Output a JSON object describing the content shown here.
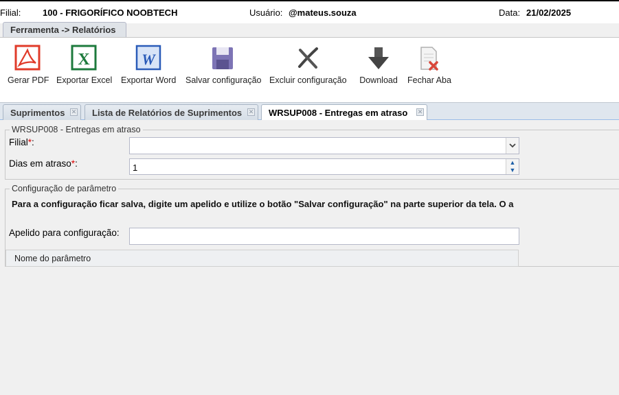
{
  "header": {
    "filial_label": "Filial:",
    "filial_value": "100 - FRIGORÍFICO NOOBTECH",
    "usuario_label": "Usuário:",
    "usuario_value": "@mateus.souza",
    "data_label": "Data:",
    "data_value": "21/02/2025"
  },
  "tool_tab": "Ferramenta -> Relatórios",
  "toolbar": {
    "gerar_pdf": "Gerar PDF",
    "exportar_excel": "Exportar Excel",
    "exportar_word": "Exportar Word",
    "salvar_config": "Salvar configuração",
    "excluir_config": "Excluir configuração",
    "download": "Download",
    "fechar_aba": "Fechar Aba"
  },
  "tabs": [
    {
      "label": "Suprimentos"
    },
    {
      "label": "Lista de Relatórios de Suprimentos"
    },
    {
      "label": "WRSUP008 - Entregas em atraso"
    }
  ],
  "form": {
    "legend": "WRSUP008 - Entregas em atraso",
    "filial_label": "Filial",
    "filial_value": "",
    "dias_label": "Dias em atraso",
    "dias_value": "1",
    "required_mark": "*",
    "colon": ":"
  },
  "config": {
    "legend": "Configuração de parâmetro",
    "info": "Para a configuração ficar salva, digite um apelido e utilize o botão \"Salvar configuração\" na parte superior da tela.  O a",
    "apelido_label": "Apelido para configuração:",
    "apelido_value": "",
    "grid_header": "Nome do parâmetro"
  },
  "colors": {
    "accent": "#99bbe8",
    "required": "#dd0000",
    "pdf": "#e03b2a",
    "excel": "#1d7a3c",
    "word": "#2a5bb8"
  }
}
